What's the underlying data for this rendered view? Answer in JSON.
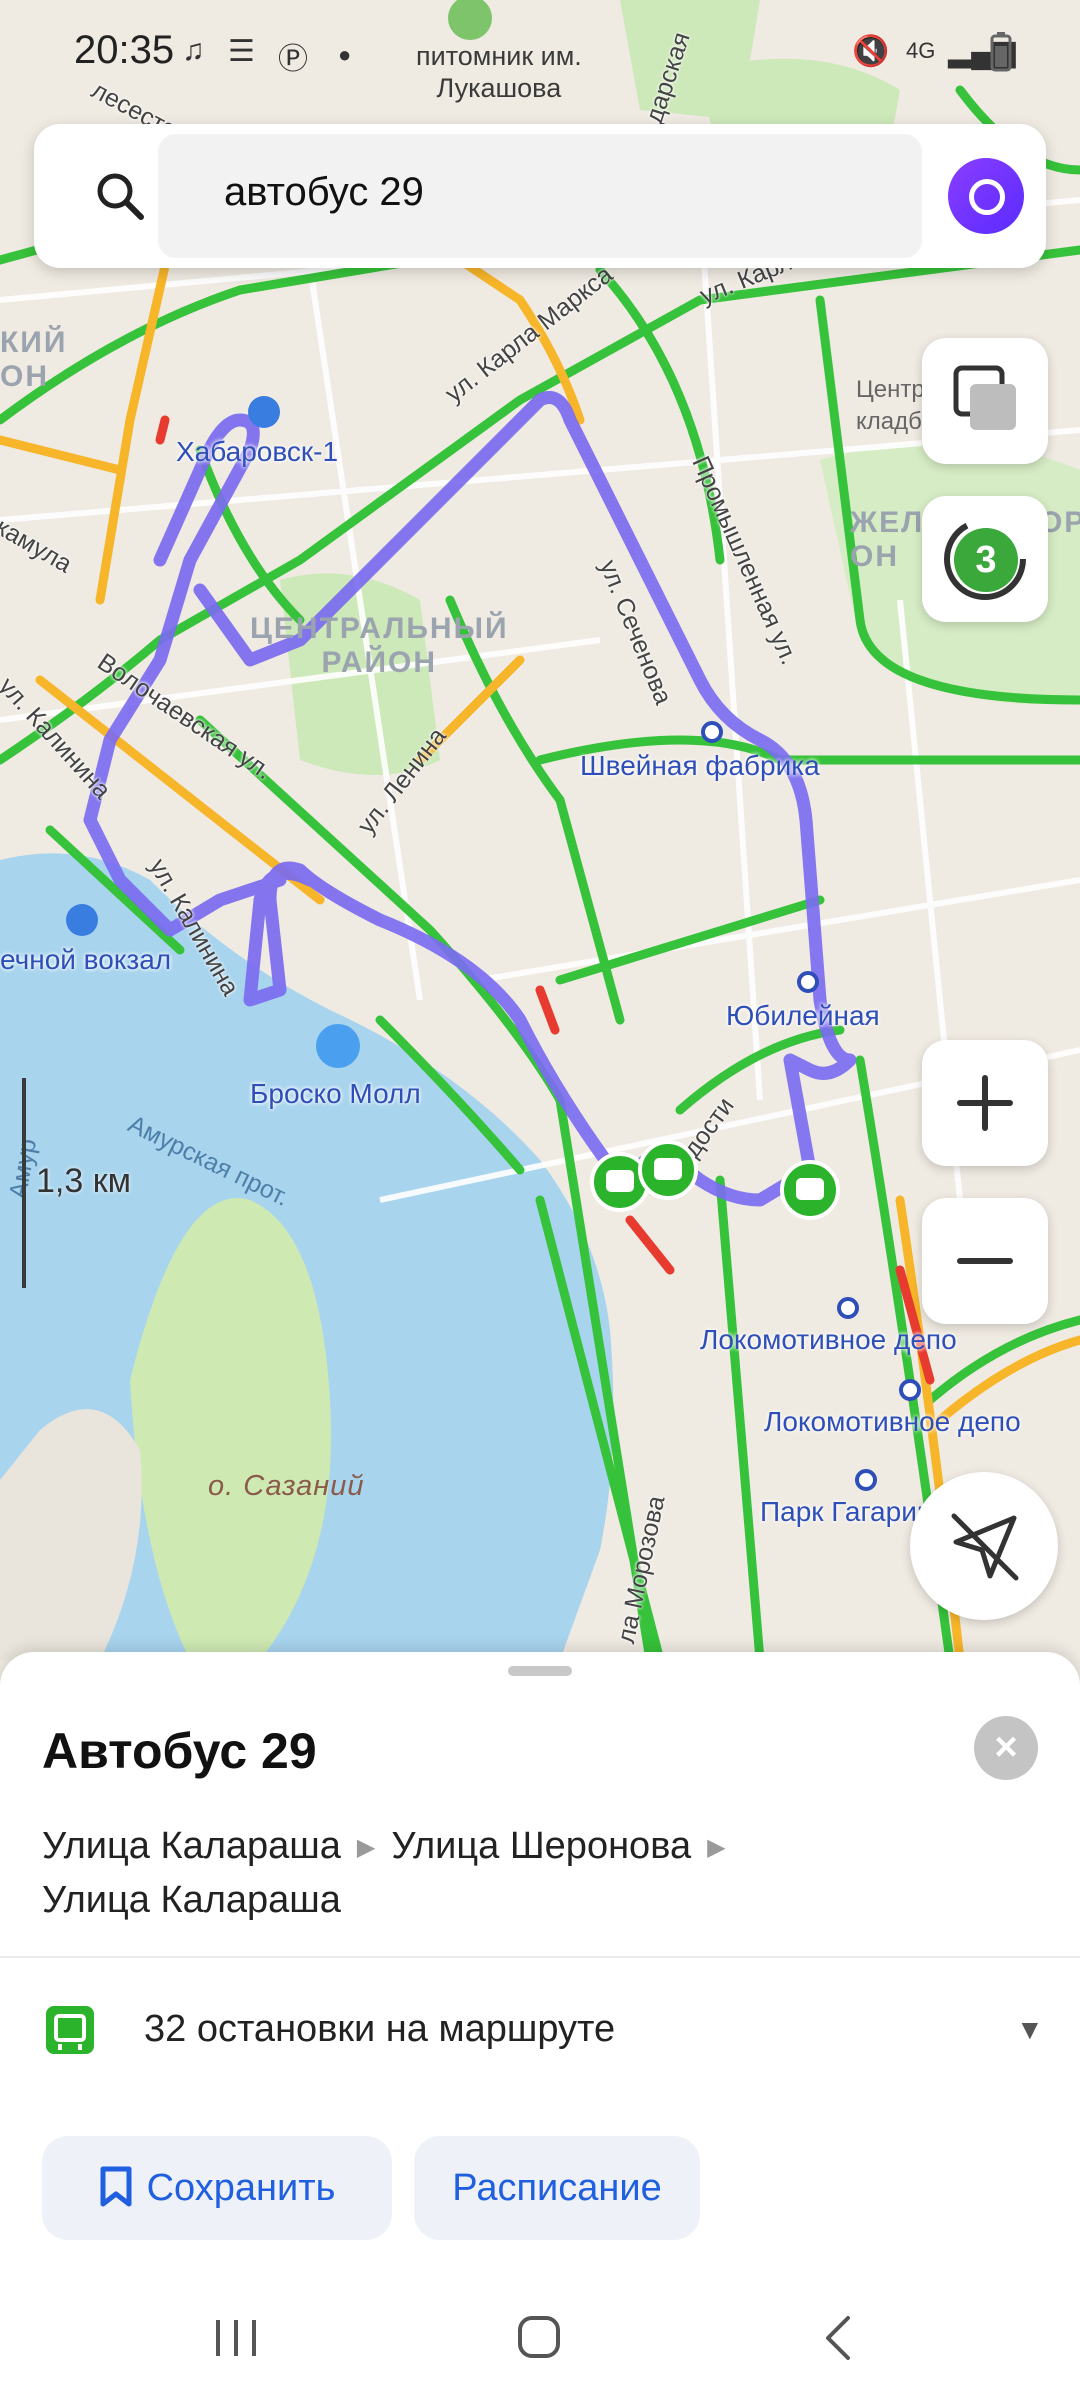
{
  "status_bar": {
    "time": "20:35",
    "icons": [
      "music-icon",
      "grid-icon",
      "pinterest-icon",
      "dot-icon",
      "mute-icon",
      "4g-icon",
      "signal-icon",
      "battery-icon"
    ],
    "network": "4G"
  },
  "search": {
    "query": "автобус 29",
    "icons": [
      "search-icon",
      "alice-assistant-icon"
    ]
  },
  "map_controls": {
    "traffic_level": "3",
    "zoom_in": "+",
    "zoom_out": "−",
    "scale": "1,3 км"
  },
  "map_labels": {
    "nursery": "питомник им.\nЛукашова",
    "district_central": "ЦЕНТРАЛЬНЫЙ\nРАЙОН",
    "district_left": "КИЙ\nОН",
    "district_right": "ЖЕЛЕЗНОДОР\nОН",
    "cemetery": "Центр\nкладбище",
    "island": "о. Сазаний",
    "stops": {
      "khabarovsk1": "Хабаровск-1",
      "sewing_factory": "Швейная фабрика",
      "jubilee": "Юбилейная",
      "brosko": "Броско Молл",
      "river_station": "ечной вокзал",
      "depot1": "Локомотивное депо",
      "depot2": "Локомотивное депо",
      "gagarin_park": "Парк Гагарина"
    },
    "streets": {
      "karla_marksa": "ул. Карла Маркса",
      "sechenova": "ул. Сеченова",
      "promyshlennaya": "Промышленная ул.",
      "volochaevskaya": "Волочаевская ул.",
      "lenina": "ул. Ленина",
      "kalinina1": "ул. Калинина",
      "kalinina2": "ул. Калинина",
      "amurskaya": "Амурская прот.",
      "morozova": "ла Морозова",
      "karla_top": "ул. Карла",
      "zhamula": "жамула",
      "koleso": "лесеста",
      "darskaya": "дарская",
      "amur": "Амур",
      "dosti": "дости"
    }
  },
  "route_card": {
    "title": "Автобус 29",
    "path": [
      "Улица Калараша",
      "Улица Шеронова",
      "Улица Калараша"
    ],
    "stops_count": "32 остановки на маршруте",
    "save_button": "Сохранить",
    "schedule_button": "Расписание"
  },
  "colors": {
    "route": "#7b6cf0",
    "traffic_green": "#36c23a",
    "traffic_yellow": "#f7b529",
    "traffic_red": "#e63b2e",
    "water": "#a8d4ee",
    "park": "#cde8b9",
    "accent_blue": "#1f5fe0",
    "stop_green": "#2bb32b"
  }
}
